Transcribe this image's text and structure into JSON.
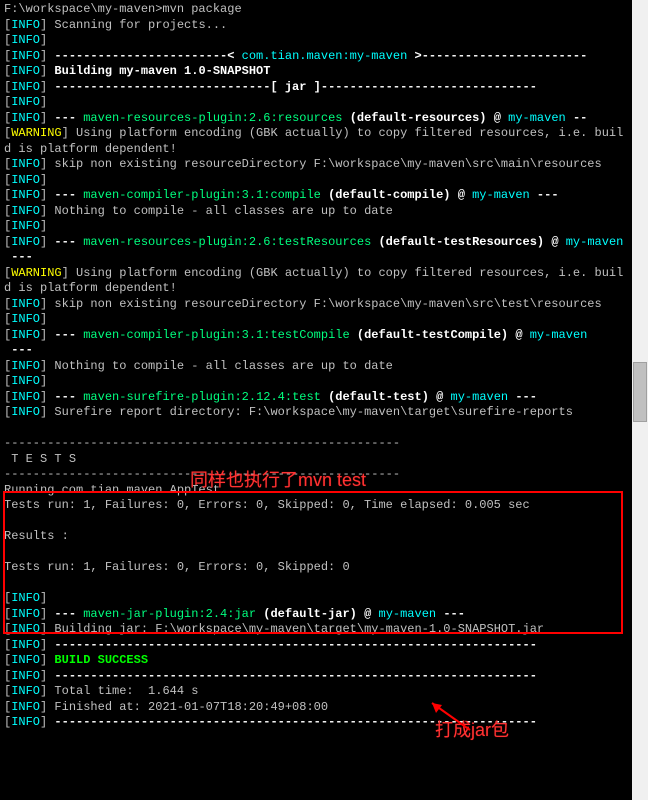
{
  "prompt": "F:\\workspace\\my-maven>mvn package",
  "info_label": "INFO",
  "warn_label": "WARNING",
  "lines": {
    "scanning": "Scanning for projects...",
    "dash_project": "------------------------< ",
    "project_name": "com.tian.maven:my-maven",
    "dash_project_end": " >-----------------------",
    "building": "Building my-maven 1.0-SNAPSHOT",
    "jar_dash": "------------------------------[ jar ]------------------------------",
    "plugin_res": "maven-resources-plugin:2.6:resources",
    "default_res": "(default-resources)",
    "at": "@",
    "mod": "my-maven",
    "warn_gbk": "Using platform encoding (GBK actually) to copy filtered resources, i.e. build is platform dependent!",
    "skip_main": "skip non existing resourceDirectory F:\\workspace\\my-maven\\src\\main\\resources",
    "plugin_compile": "maven-compiler-plugin:3.1:compile",
    "default_compile": "(default-compile)",
    "nothing_compile": "Nothing to compile - all classes are up to date",
    "plugin_testres": "maven-resources-plugin:2.6:testResources",
    "default_testres": "(default-testResources)",
    "skip_test": "skip non existing resourceDirectory F:\\workspace\\my-maven\\src\\test\\resources",
    "plugin_testcompile": "maven-compiler-plugin:3.1:testCompile",
    "default_testcompile": "(default-testCompile)",
    "plugin_surefire": "maven-surefire-plugin:2.12.4:test",
    "default_test": "(default-test)",
    "surefire_dir": "Surefire report directory: F:\\workspace\\my-maven\\target\\surefire-reports",
    "tests_sep": "-------------------------------------------------------",
    "tests_hdr": " T E S T S",
    "running": "Running com.tian.maven.AppTest",
    "tests_line": "Tests run: 1, Failures: 0, Errors: 0, Skipped: 0, Time elapsed: 0.005 sec",
    "results": "Results :",
    "tests_summary": "Tests run: 1, Failures: 0, Errors: 0, Skipped: 0",
    "plugin_jar": "maven-jar-plugin:2.4:jar",
    "default_jar": "(default-jar)",
    "building_jar": "Building jar: F:\\workspace\\my-maven\\target\\my-maven-1.0-SNAPSHOT.jar",
    "line_dashes": "-------------------------------------------------------------------",
    "build_success": "BUILD SUCCESS",
    "total_time": "Total time:  1.644 s",
    "finished_at": "Finished at: 2021-01-07T18:20:49+08:00",
    "dashes3": "---",
    "dashes2": "--"
  },
  "annotations": {
    "mvn_test": "同样也执行了mvn test",
    "jar_pack": "打成jar包"
  },
  "colors": {
    "cyan": "#00ffff",
    "yellow": "#ffff00",
    "green": "#00ff7f",
    "red": "#ff0000"
  }
}
